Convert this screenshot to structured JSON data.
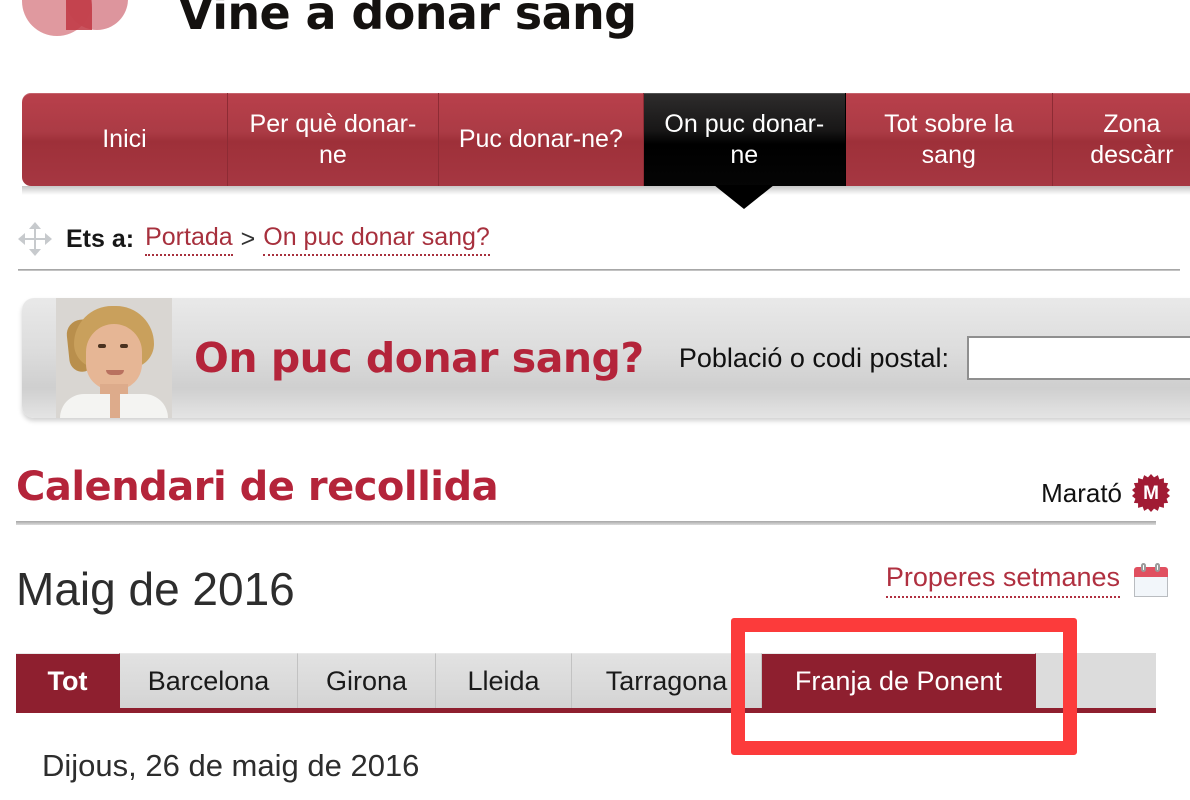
{
  "header": {
    "site_title": "Vine a donar sang",
    "logo_icon": "blood-drops-logo"
  },
  "main_nav": {
    "items": [
      {
        "label": "Inici",
        "active": false
      },
      {
        "label": "Per què donar-ne",
        "active": false
      },
      {
        "label": "Puc donar-ne?",
        "active": false
      },
      {
        "label": "On puc donar-ne",
        "active": true
      },
      {
        "label": "Tot sobre la sang",
        "active": false
      },
      {
        "label": "Zona descàrr",
        "active": false
      }
    ]
  },
  "breadcrumb": {
    "prefix": "Ets a:",
    "home": "Portada",
    "separator": ">",
    "current": "On puc donar sang?",
    "icon": "move-arrows-icon"
  },
  "banner": {
    "title": "On puc donar sang?",
    "search_label": "Població o codi postal:",
    "search_value": "",
    "search_placeholder": ""
  },
  "calendar_section": {
    "title": "Calendari de recollida",
    "marato_label": "Marató",
    "marato_badge": "M",
    "month": "Maig de 2016",
    "weeks_link": "Properes setmanes",
    "calendar_icon": "calendar-icon"
  },
  "region_tabs": {
    "items": [
      {
        "label": "Tot",
        "state": "active"
      },
      {
        "label": "Barcelona",
        "state": "normal"
      },
      {
        "label": "Girona",
        "state": "normal"
      },
      {
        "label": "Lleida",
        "state": "normal"
      },
      {
        "label": "Tarragona",
        "state": "normal"
      },
      {
        "label": "Franja de Ponent",
        "state": "selected"
      }
    ]
  },
  "day_list": {
    "first_day": "Dijous, 26 de maig de 2016"
  },
  "colors": {
    "brand_red": "#b4243a",
    "nav_red": "#ab3b45",
    "tab_active": "#8e1f2f",
    "link_red": "#a7303d",
    "annotation": "#fc3b3b"
  }
}
